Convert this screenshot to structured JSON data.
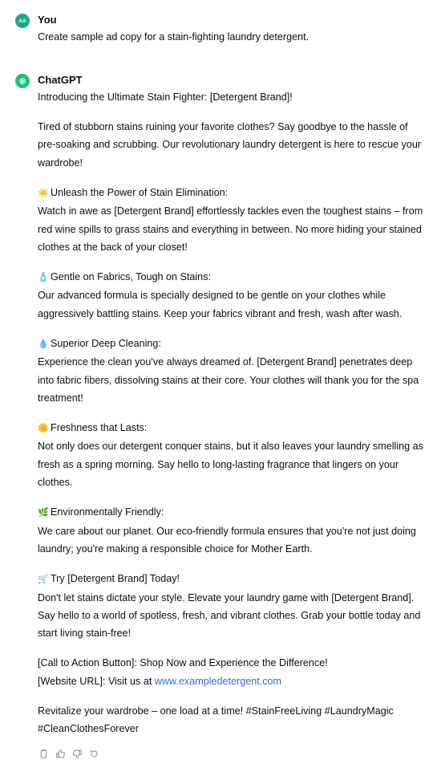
{
  "user_message": {
    "avatar_initials": "AA",
    "author": "You",
    "text": "Create sample ad copy for a stain-fighting laundry detergent."
  },
  "assistant_message": {
    "author": "ChatGPT",
    "intro": "Introducing the Ultimate Stain Fighter: [Detergent Brand]!",
    "p1": [
      "Tired of stubborn stains ruining your favorite clothes? Say goodbye to the hassle of",
      "pre-soaking and scrubbing. Our revolutionary laundry detergent is here to rescue your",
      "wardrobe!"
    ],
    "sections": [
      {
        "emoji": "☀️",
        "heading": "Unleash the Power of Stain Elimination:",
        "lines": [
          "Watch in awe as [Detergent Brand] effortlessly tackles even the toughest stains – from",
          "red wine spills to grass stains and everything in between. No more hiding your stained",
          "clothes at the back of your closet!"
        ]
      },
      {
        "emoji": "🧴",
        "heading": "Gentle on Fabrics, Tough on Stains:",
        "lines": [
          "Our advanced formula is specially designed to be gentle on your clothes while",
          "aggressively battling stains. Keep your fabrics vibrant and fresh, wash after wash."
        ]
      },
      {
        "emoji": "💧",
        "heading": "Superior Deep Cleaning:",
        "lines": [
          "Experience the clean you've always dreamed of. [Detergent Brand] penetrates deep",
          "into fabric fibers, dissolving stains at their core. Your clothes will thank you for the spa",
          "treatment!"
        ]
      },
      {
        "emoji": "🌼",
        "heading": "Freshness that Lasts:",
        "lines": [
          "Not only does our detergent conquer stains, but it also leaves your laundry smelling as",
          "fresh as a spring morning. Say hello to long-lasting fragrance that lingers on your",
          "clothes."
        ]
      },
      {
        "emoji": "🌿",
        "heading": "Environmentally Friendly:",
        "lines": [
          "We care about our planet. Our eco-friendly formula ensures that you're not just doing",
          "laundry; you're making a responsible choice for Mother Earth."
        ]
      },
      {
        "emoji": "🛒",
        "heading": "Try [Detergent Brand] Today!",
        "lines": [
          "Don't let stains dictate your style. Elevate your laundry game with [Detergent Brand].",
          "Say hello to a world of spotless, fresh, and vibrant clothes. Grab your bottle today and",
          "start living stain-free!"
        ]
      }
    ],
    "cta_line": "[Call to Action Button]: Shop Now and Experience the Difference!",
    "url_prefix": "[Website URL]: Visit us at ",
    "url_link": "www.exampledetergent.com",
    "closing": [
      "Revitalize your wardrobe – one load at a time! #StainFreeLiving #LaundryMagic",
      "#CleanClothesForever"
    ]
  },
  "actions": {
    "copy": "copy-icon",
    "thumbs_up": "thumbs-up-icon",
    "thumbs_down": "thumbs-down-icon",
    "regenerate": "regenerate-icon"
  },
  "colors": {
    "user_avatar": "#1fa588",
    "bot_avatar": "#19c37d",
    "link": "#3567d7"
  }
}
